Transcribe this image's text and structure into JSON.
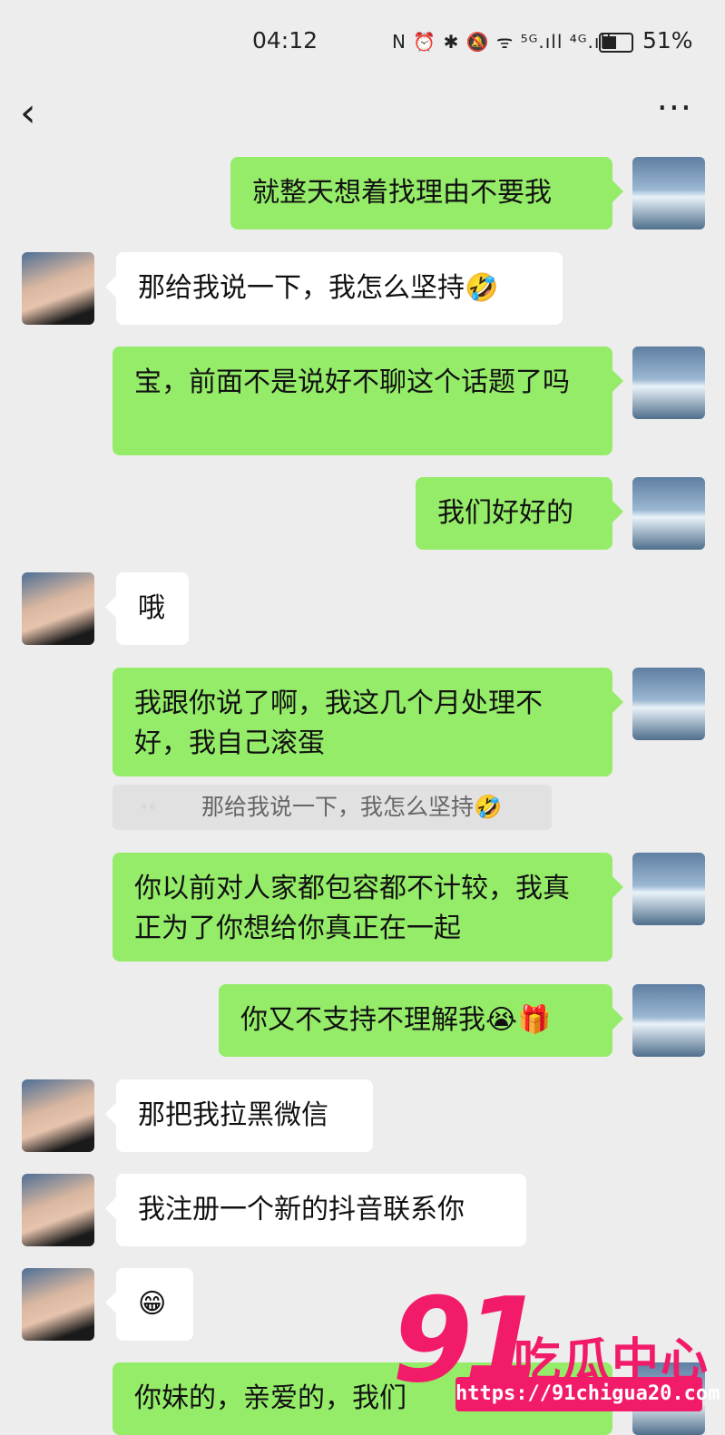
{
  "status_bar": {
    "time": "04:12",
    "icons_text": "N ⏰ ✱ 🔕 ᯤ ⁵ᴳ.ıll ⁴ᴳ.ıll",
    "battery_pct": "51%",
    "battery_level": 0.51
  },
  "nav": {
    "back_icon": "‹",
    "more_icon": "···"
  },
  "messages": [
    {
      "sender": "self",
      "text": "就整天想着找理由不要我"
    },
    {
      "sender": "other",
      "text": "那给我说一下，我怎么坚持🤣"
    },
    {
      "sender": "self",
      "text": "宝，前面不是说好不聊这个话题了吗"
    },
    {
      "sender": "self",
      "text": "我们好好的"
    },
    {
      "sender": "other",
      "text": "哦"
    },
    {
      "sender": "self",
      "text": "我跟你说了啊，我这几个月处理不好，我自己滚蛋"
    },
    {
      "sender": "self",
      "text": "你以前对人家都包容都不计较，我真正为了你想给你真正在一起"
    },
    {
      "sender": "self",
      "text": "你又不支持不理解我😭🎁"
    },
    {
      "sender": "other",
      "text": "那把我拉黑微信"
    },
    {
      "sender": "other",
      "text": "我注册一个新的抖音联系你"
    },
    {
      "sender": "other",
      "text": "😁"
    },
    {
      "sender": "self",
      "text": "你妹的，亲爱的，我们"
    }
  ],
  "quote": {
    "text": "那给我说一下，我怎么坚持🤣"
  },
  "watermark": {
    "number": "91",
    "text": "吃瓜中心",
    "url": "https://91chigua20.com"
  }
}
